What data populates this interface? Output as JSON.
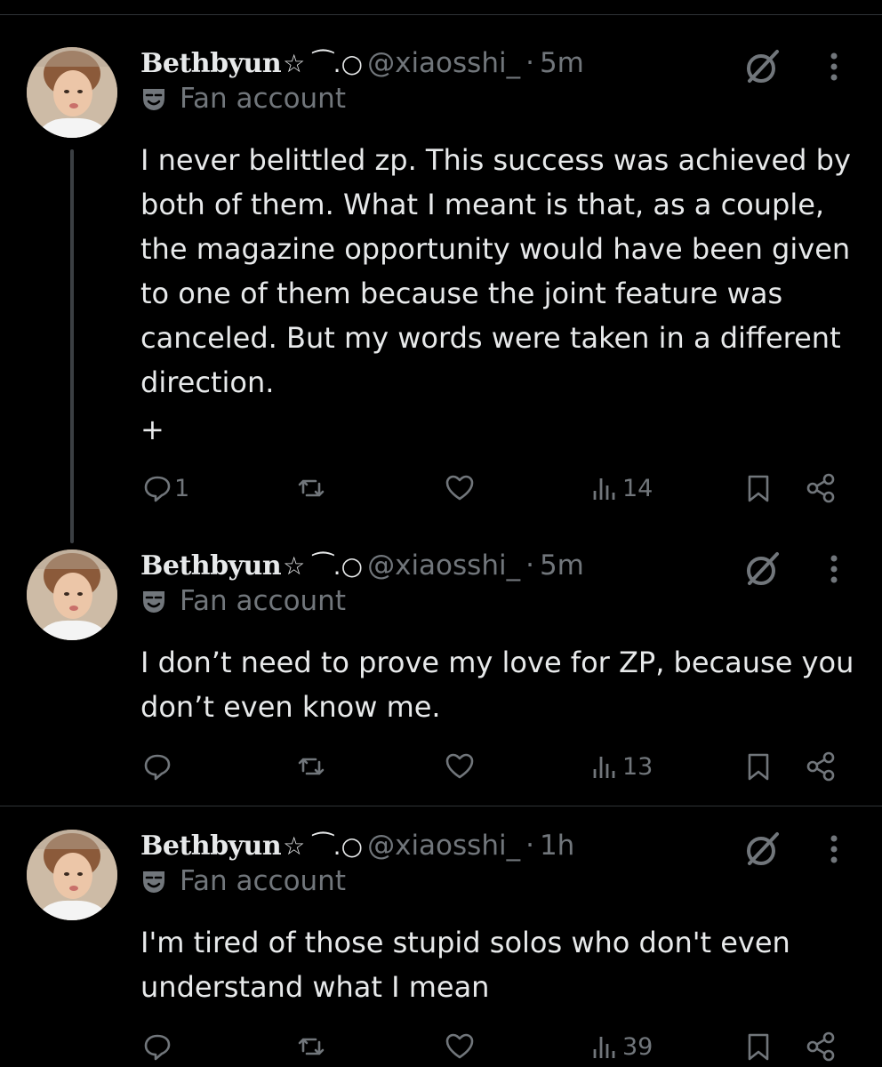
{
  "posts": [
    {
      "name": "Bethbyun",
      "name_symbols": "☆ ⁀.○",
      "handle": "@xiaosshi_",
      "separator": "·",
      "time": "5m",
      "badge_label": "Fan account",
      "text": "I never belittled zp. This success was achieved by both of them. What I meant is that, as a couple, the magazine opportunity would have been given to one of them because the joint feature was canceled. But my words were taken in a different direction.",
      "extra": "+",
      "replies": "1",
      "views": "14"
    },
    {
      "name": "Bethbyun",
      "name_symbols": "☆ ⁀.○",
      "handle": "@xiaosshi_",
      "separator": "·",
      "time": "5m",
      "badge_label": "Fan account",
      "text": "I don’t need to prove my love for ZP, because you don’t even know me.",
      "views": "13"
    },
    {
      "name": "Bethbyun",
      "name_symbols": "☆ ⁀.○",
      "handle": "@xiaosshi_",
      "separator": "·",
      "time": "1h",
      "badge_label": "Fan account",
      "text": "I'm tired of those stupid solos who don't even understand what I mean",
      "views": "39"
    }
  ],
  "icons": {
    "grok": "grok-icon",
    "more": "more-dots-icon",
    "badge": "mask-icon",
    "reply": "reply-icon",
    "repost": "repost-icon",
    "like": "heart-icon",
    "views": "views-bar-icon",
    "bookmark": "bookmark-icon",
    "share": "share-icon"
  },
  "colors": {
    "background": "#000000",
    "text": "#e7e9ea",
    "muted": "#71767b",
    "divider": "#2f3336"
  }
}
